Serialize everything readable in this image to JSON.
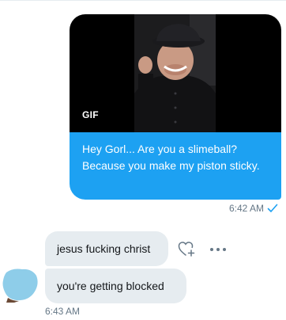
{
  "sent": {
    "gif_badge": "GIF",
    "text": "Hey Gorl... Are you a slimeball? Because you make my piston sticky.",
    "time": "6:42 AM",
    "status_icon": "check-icon"
  },
  "received": {
    "messages": [
      "jesus fucking christ",
      "you're getting blocked"
    ],
    "time": "6:43 AM"
  },
  "actions": {
    "react_icon": "heart-plus-icon",
    "more_icon": "more-dots-icon"
  },
  "colors": {
    "accent": "#1da1f2",
    "bubble_gray": "#e6ecf0",
    "meta_text": "#657786",
    "avatar": "#8ecde9"
  }
}
